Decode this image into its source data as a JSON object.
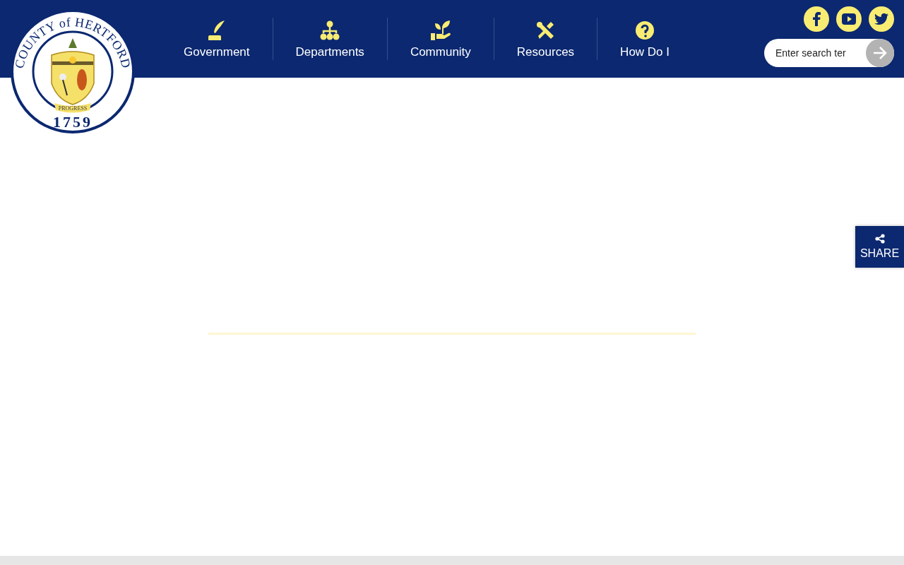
{
  "logo": {
    "name": "COUNTY of HERTFORD",
    "year": "1759",
    "motto": "PROGRESS"
  },
  "nav": [
    {
      "label": "Government",
      "kind": "quill"
    },
    {
      "label": "Departments",
      "kind": "org"
    },
    {
      "label": "Community",
      "kind": "sprout"
    },
    {
      "label": "Resources",
      "kind": "tools"
    },
    {
      "label": "How Do I",
      "kind": "help"
    }
  ],
  "social": [
    {
      "kind": "facebook"
    },
    {
      "kind": "youtube"
    },
    {
      "kind": "twitter"
    }
  ],
  "search": {
    "placeholder": "Enter search ter"
  },
  "share": {
    "label": "SHARE"
  }
}
